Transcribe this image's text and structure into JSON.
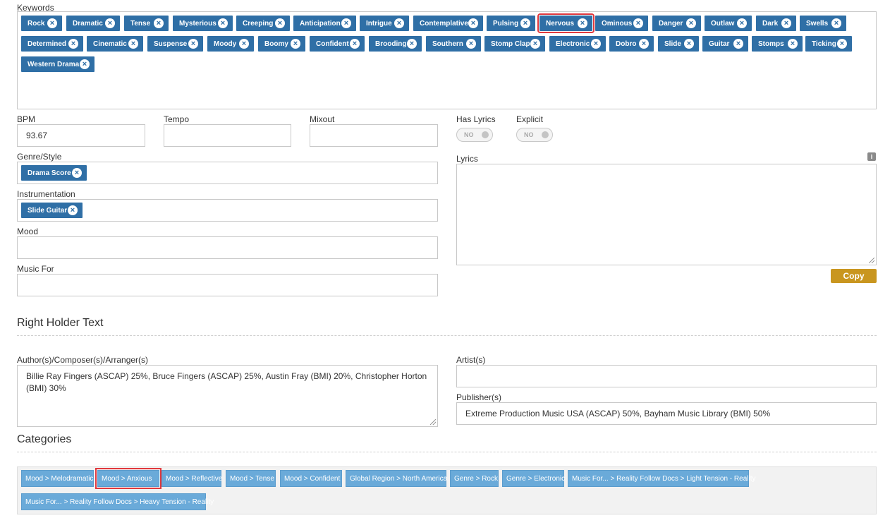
{
  "keywords": {
    "label": "Keywords",
    "tags": [
      "Rock",
      "Dramatic",
      "Tense",
      "Mysterious",
      "Creeping",
      "Anticipation",
      "Intrigue",
      "Contemplative",
      "Pulsing",
      "Nervous",
      "Ominous",
      "Danger",
      "Outlaw",
      "Dark",
      "Swells",
      "Determined",
      "Cinematic",
      "Suspense",
      "Moody",
      "Boomy",
      "Confident",
      "Brooding",
      "Southern",
      "Stomp Clap",
      "Electronic",
      "Dobro",
      "Slide",
      "Guitar",
      "Stomps",
      "Ticking",
      "Western Drama"
    ],
    "highlighted": "Nervous"
  },
  "fields": {
    "bpm_label": "BPM",
    "bpm_value": "93.67",
    "tempo_label": "Tempo",
    "mixout_label": "Mixout",
    "has_lyrics_label": "Has Lyrics",
    "has_lyrics_value": "NO",
    "explicit_label": "Explicit",
    "explicit_value": "NO",
    "genre_label": "Genre/Style",
    "genre_tags": [
      "Drama Score"
    ],
    "instrumentation_label": "Instrumentation",
    "instrumentation_tags": [
      "Slide Guitar"
    ],
    "mood_label": "Mood",
    "music_for_label": "Music For",
    "lyrics_label": "Lyrics",
    "info_icon": "i",
    "copy_label": "Copy"
  },
  "rights": {
    "title": "Right Holder Text",
    "authors_label": "Author(s)/Composer(s)/Arranger(s)",
    "authors_value": "Billie Ray Fingers (ASCAP) 25%, Bruce Fingers (ASCAP) 25%, Austin Fray (BMI) 20%, Christopher Horton (BMI) 30%",
    "artists_label": "Artist(s)",
    "publishers_label": "Publisher(s)",
    "publishers_value": "Extreme Production Music USA (ASCAP) 50%, Bayham Music Library (BMI) 50%"
  },
  "categories": {
    "title": "Categories",
    "items": [
      "Mood > Melodramatic",
      "Mood > Anxious",
      "Mood > Reflective",
      "Mood > Tense",
      "Mood > Confident",
      "Global Region > North America",
      "Genre > Rock",
      "Genre > Electronic",
      "Music For... > Reality Follow Docs > Light Tension - Reality",
      "Music For... > Reality Follow Docs > Heavy Tension - Reality"
    ],
    "highlighted": "Mood > Anxious"
  },
  "colors": {
    "tag_bg": "#2f6fa6",
    "category_bg": "#6aaad9",
    "highlight": "#e0393e",
    "copy_button": "#c9961f"
  },
  "icons": {
    "tag_remove": "close-circle-icon",
    "info": "info-icon"
  }
}
